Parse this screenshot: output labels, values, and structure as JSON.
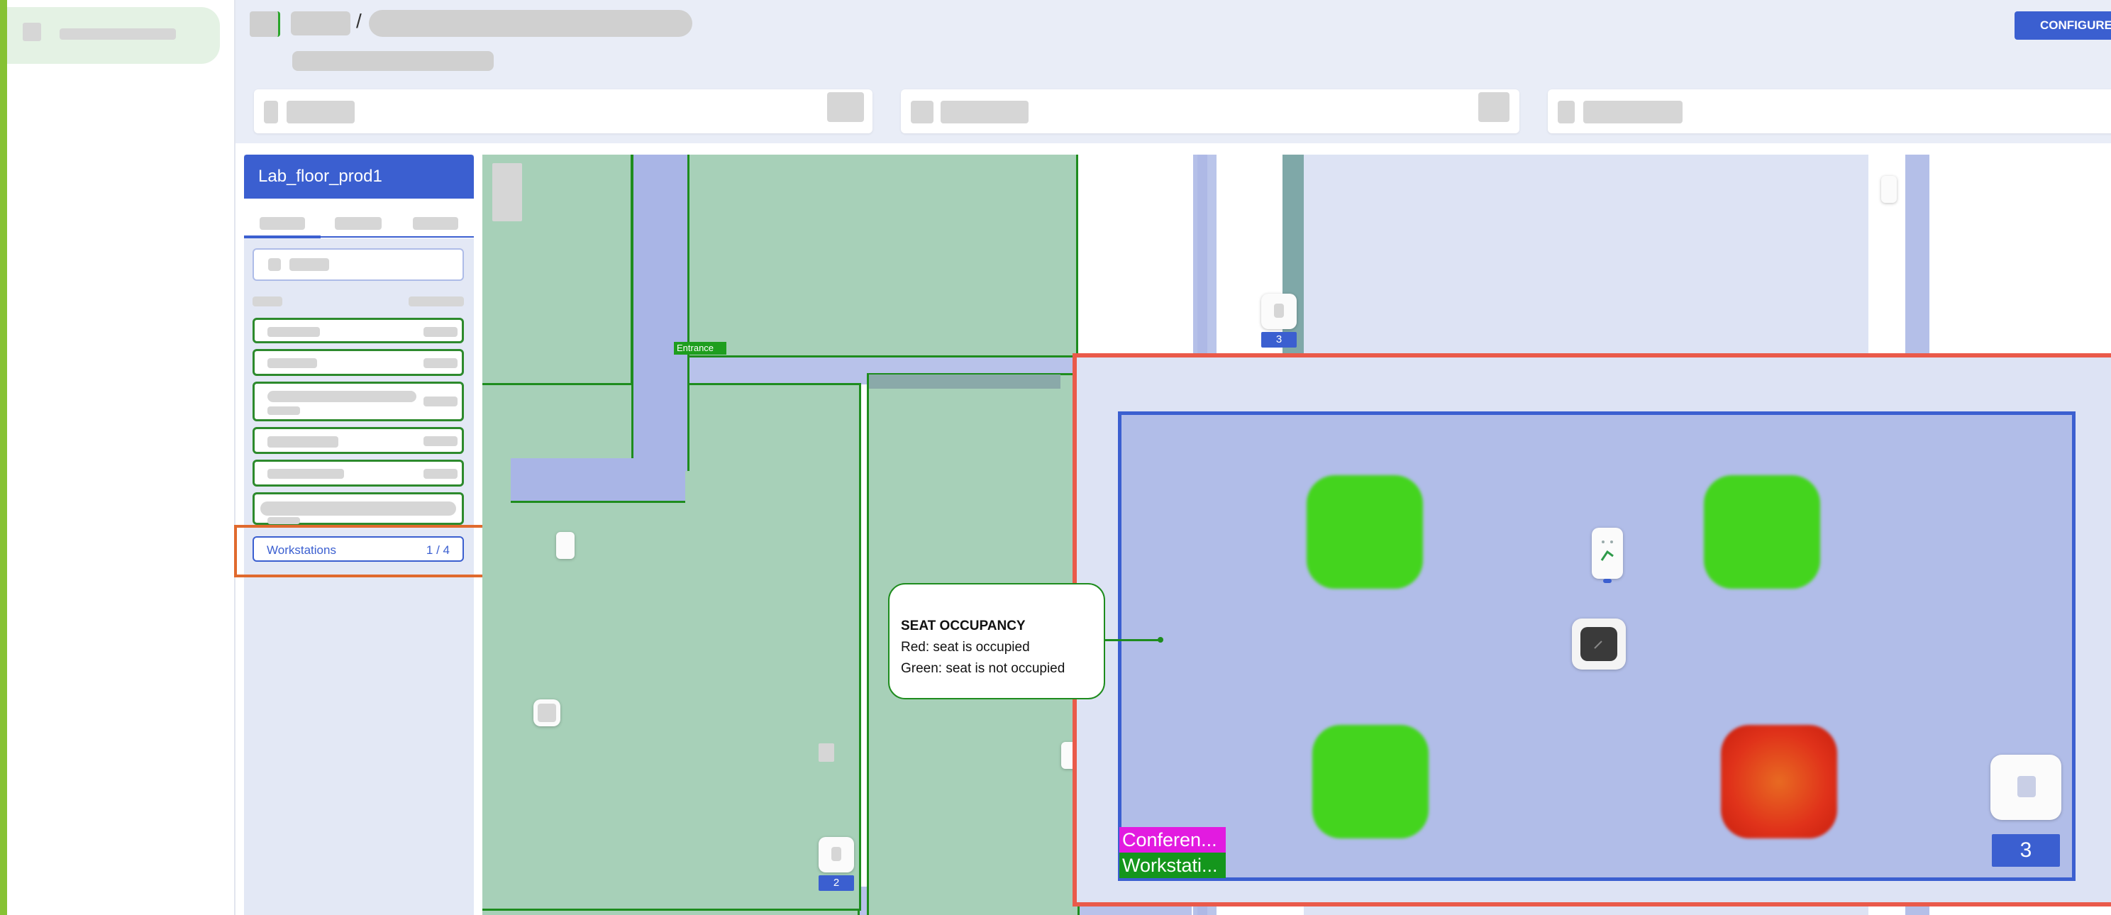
{
  "header": {
    "configure_button": "CONFIGURE F"
  },
  "sidebar": {
    "floor_title": "Lab_floor_prod1",
    "workstations": {
      "label": "Workstations",
      "count": "1 / 4"
    }
  },
  "map": {
    "entrance_label": "Entrance",
    "device_counts": [
      "3",
      "2",
      "3"
    ],
    "zone_labels": [
      "Conferen...",
      "Workstati..."
    ],
    "colors": {
      "occupied": "#e0321a",
      "free": "#44d41e",
      "conference": "#e21be0",
      "workstation": "#14961c",
      "highlight": "#ea5a4a",
      "callout": "#1e8c1e"
    }
  },
  "callout": {
    "title": "SEAT OCCUPANCY",
    "line1": "Red: seat is occupied",
    "line2": "Green: seat is not occupied"
  }
}
